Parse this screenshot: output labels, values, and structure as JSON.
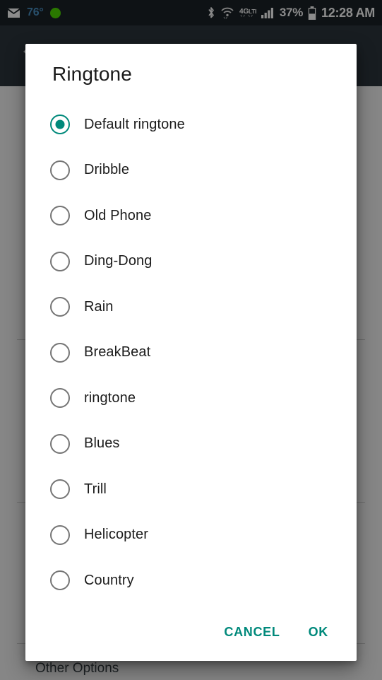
{
  "status_bar": {
    "mail_icon": "envelope-icon",
    "temperature": "76°",
    "notification_dot": "green-status-dot",
    "bluetooth_icon": "bluetooth-icon",
    "wifi_icon": "wifi-icon",
    "network_type": "4G",
    "signal_icon": "signal-bars-icon",
    "battery_percent": "37%",
    "battery_icon": "battery-icon",
    "clock": "12:28 AM",
    "background_color": "#1b2227"
  },
  "background_app": {
    "back_icon": "back-arrow-icon",
    "toolbar_color": "#2c363c",
    "other_options_label": "Other Options"
  },
  "dialog": {
    "title": "Ringtone",
    "accent_color": "#00897b",
    "unselected_radio_color": "#757575",
    "selected_index": 0,
    "options": [
      {
        "label": "Default ringtone",
        "selected": true
      },
      {
        "label": "Dribble",
        "selected": false
      },
      {
        "label": "Old Phone",
        "selected": false
      },
      {
        "label": "Ding-Dong",
        "selected": false
      },
      {
        "label": "Rain",
        "selected": false
      },
      {
        "label": "BreakBeat",
        "selected": false
      },
      {
        "label": "ringtone",
        "selected": false
      },
      {
        "label": "Blues",
        "selected": false
      },
      {
        "label": "Trill",
        "selected": false
      },
      {
        "label": "Helicopter",
        "selected": false
      },
      {
        "label": "Country",
        "selected": false
      }
    ],
    "cancel_label": "CANCEL",
    "ok_label": "OK"
  }
}
